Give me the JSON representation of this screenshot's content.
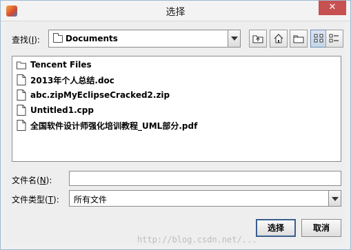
{
  "window": {
    "title": "选择",
    "close_glyph": "✕"
  },
  "look_in": {
    "label": "查找(",
    "mnemonic": "I",
    "label_suffix": "):",
    "value": "Documents"
  },
  "toolbar": {
    "up_icon": "up-folder-icon",
    "home_icon": "home-icon",
    "new_folder_icon": "new-folder-icon",
    "list_icon": "list-view-icon",
    "details_icon": "details-view-icon"
  },
  "files": [
    {
      "name": "Tencent Files",
      "type": "folder"
    },
    {
      "name": "2013年个人总结.doc",
      "type": "file"
    },
    {
      "name": "abc.zipMyEclipseCracked2.zip",
      "type": "file"
    },
    {
      "name": "Untitled1.cpp",
      "type": "file"
    },
    {
      "name": "全国软件设计师强化培训教程_UML部分.pdf",
      "type": "file"
    }
  ],
  "file_name": {
    "label": "文件名(",
    "mnemonic": "N",
    "label_suffix": "):",
    "value": ""
  },
  "file_type": {
    "label": "文件类型(",
    "mnemonic": "T",
    "label_suffix": "):",
    "value": "所有文件"
  },
  "buttons": {
    "ok": "选择",
    "cancel": "取消"
  },
  "watermark": "http://blog.csdn.net/..."
}
